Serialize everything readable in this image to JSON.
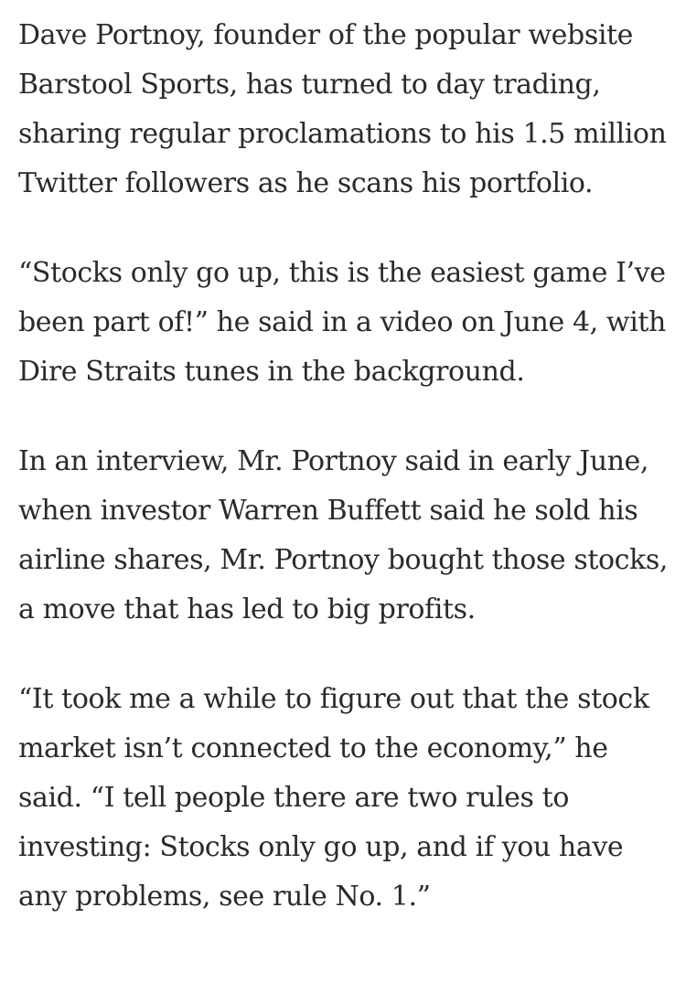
{
  "article": {
    "paragraphs": [
      "Dave Portnoy, founder of the popular website Barstool Sports, has turned to day trading, sharing regular proclamations to his 1.5 million Twitter followers as he scans his portfolio.",
      "“Stocks only go up, this is the easiest game I’ve been part of!” he said in a video on June 4, with Dire Straits tunes in the background.",
      "In an interview, Mr. Portnoy said in early June, when investor Warren Buffett said he sold his airline shares, Mr. Portnoy bought those stocks, a move that has led to big profits.",
      "“It took me a while to figure out that the stock market isn’t connected to the economy,” he said. “I tell people there are two rules to investing: Stocks only go up, and if you have any problems, see rule No. 1.”"
    ]
  }
}
